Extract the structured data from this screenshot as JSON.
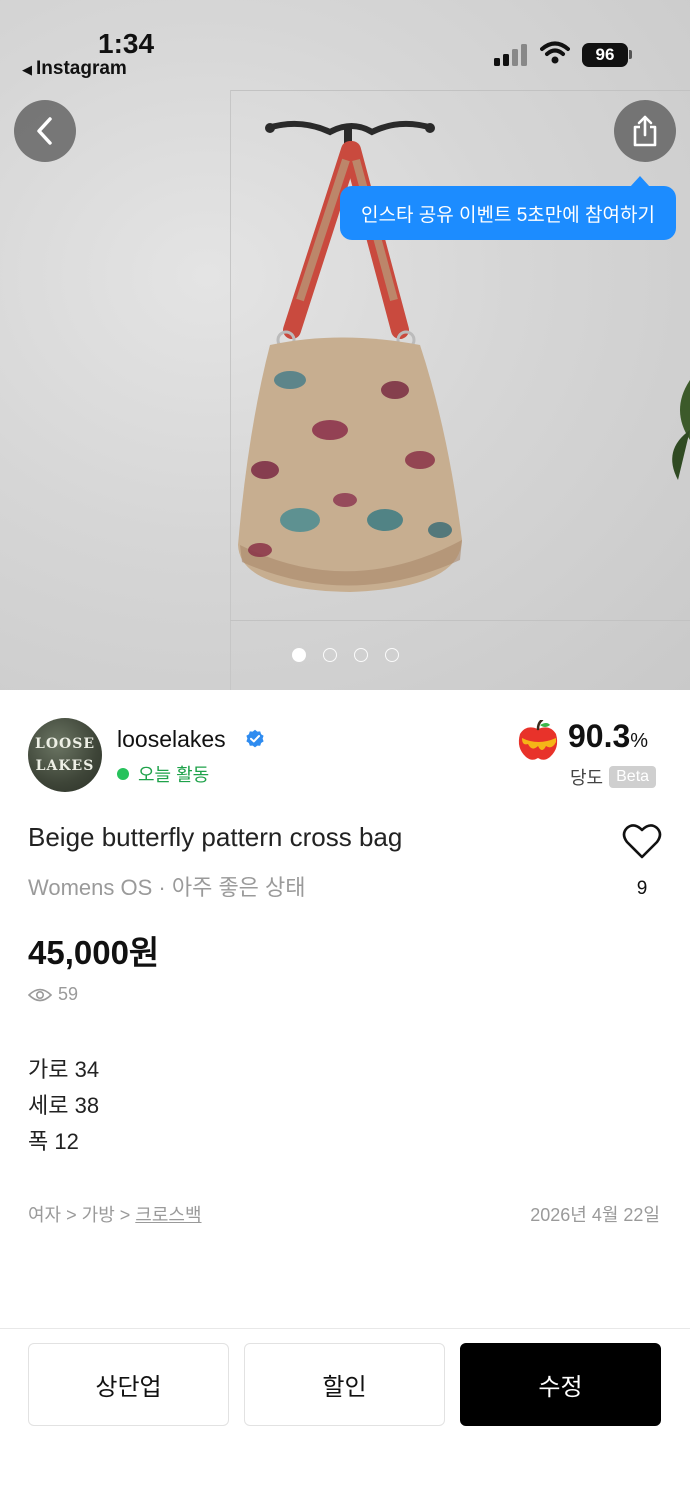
{
  "status_bar": {
    "time": "1:34",
    "back_app_label": "Instagram",
    "battery": "96"
  },
  "hero": {
    "image_subject": "beige butterfly pattern cross bag hanging on wall hook",
    "tooltip": "인스타 공유 이벤트 5초만에 참여하기",
    "page_count": 4,
    "active_page": 1
  },
  "seller": {
    "avatar_line1": "LOOSE",
    "avatar_line2": "LAKES",
    "name": "looselakes",
    "activity": "오늘 활동",
    "score_value": "90.3",
    "score_unit": "%",
    "score_label": "당도",
    "score_badge": "Beta"
  },
  "product": {
    "title": "Beige butterfly pattern cross bag",
    "subtitle": "Womens OS · 아주 좋은 상태",
    "likes": "9",
    "price": "45,000원",
    "views": "59",
    "description": [
      "가로 34",
      "세로 38",
      "폭 12"
    ],
    "category_path": "여자 > 가방 > ",
    "category_leaf": "크로스백",
    "date": "2026년 4월 22일"
  },
  "actions": {
    "bump": "상단업",
    "discount": "할인",
    "edit": "수정"
  },
  "colors": {
    "tooltip_bg": "#1c8cff",
    "active_green": "#27c25c",
    "primary_button": "#000000"
  }
}
